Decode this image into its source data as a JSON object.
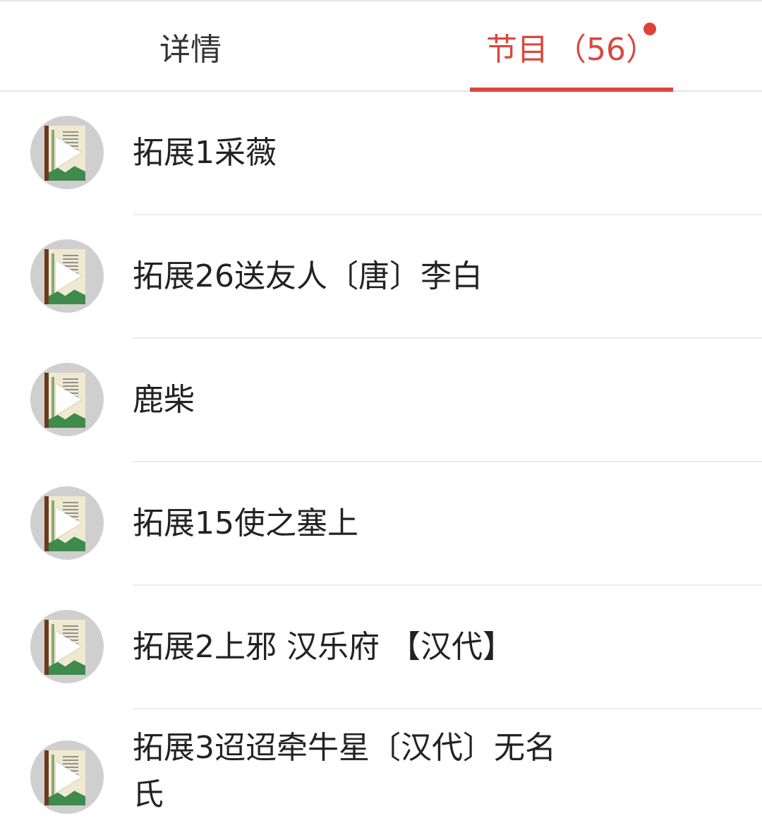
{
  "tabs": {
    "details_label": "详情",
    "episodes_label": "节目",
    "episodes_count": "（56）"
  },
  "colors": {
    "accent": "#d8483e",
    "badge_dot": "#e0403a",
    "divider": "#ececec"
  },
  "episodes": [
    {
      "title": "拓展1采薇",
      "icon": "play-icon"
    },
    {
      "title": "拓展26送友人〔唐〕李白",
      "icon": "play-icon"
    },
    {
      "title": "鹿柴",
      "icon": "play-icon"
    },
    {
      "title": "拓展15使之塞上",
      "icon": "play-icon"
    },
    {
      "title": "拓展2上邪 汉乐府 【汉代】",
      "icon": "play-icon"
    },
    {
      "title": "拓展3迢迢牵牛星〔汉代〕无名氏",
      "icon": "play-icon"
    }
  ]
}
